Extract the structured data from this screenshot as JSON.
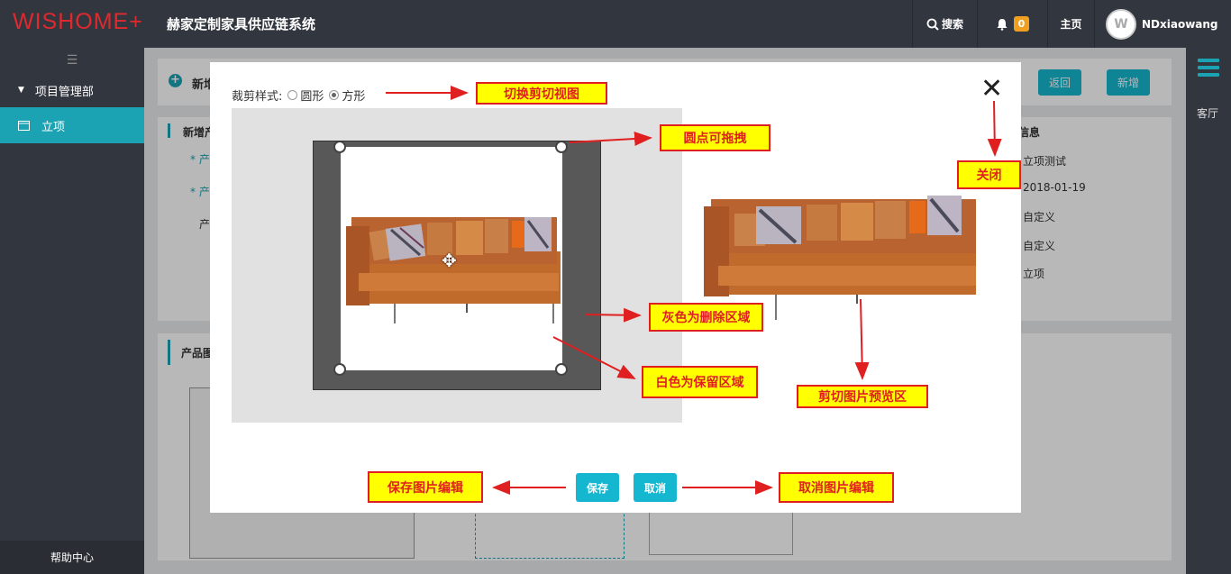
{
  "app": {
    "logo": "WISHOME+",
    "system_title": "赫家定制家具供应链系统"
  },
  "topbar": {
    "search_label": "搜索",
    "notification_count": "0",
    "home_label": "主页",
    "username": "NDxiaowang"
  },
  "sidebar": {
    "group_label": "项目管理部",
    "items": [
      {
        "label": "立项"
      }
    ],
    "help_label": "帮助中心"
  },
  "rightbar": {
    "label": "客厅"
  },
  "background": {
    "header_title": "新增",
    "back_button": "返回",
    "add_button": "新增",
    "section_left": "新增产",
    "section_right": "信息",
    "field_labels": [
      "* 产",
      "* 产",
      "产"
    ],
    "info_values": [
      "立项测试",
      "2018-01-19",
      "自定义",
      "自定义",
      "立项"
    ],
    "image_section": "产品图"
  },
  "modal": {
    "crop_style_label": "裁剪样式:",
    "options": [
      "圆形",
      "方形"
    ],
    "selected": "方形",
    "save_button": "保存",
    "cancel_button": "取消"
  },
  "annotations": {
    "switch_view": "切换剪切视图",
    "drag_dots": "圆点可拖拽",
    "close": "关闭",
    "gray_delete": "灰色为删除区域",
    "white_keep": "白色为保留区域",
    "preview_area": "剪切图片预览区",
    "save_edit": "保存图片编辑",
    "cancel_edit": "取消图片编辑"
  },
  "colors": {
    "accent": "#1ba2b3",
    "button": "#14b7cf",
    "logo": "#e0292e",
    "annotation_bg": "#ffff00",
    "annotation_border": "#e02020"
  }
}
